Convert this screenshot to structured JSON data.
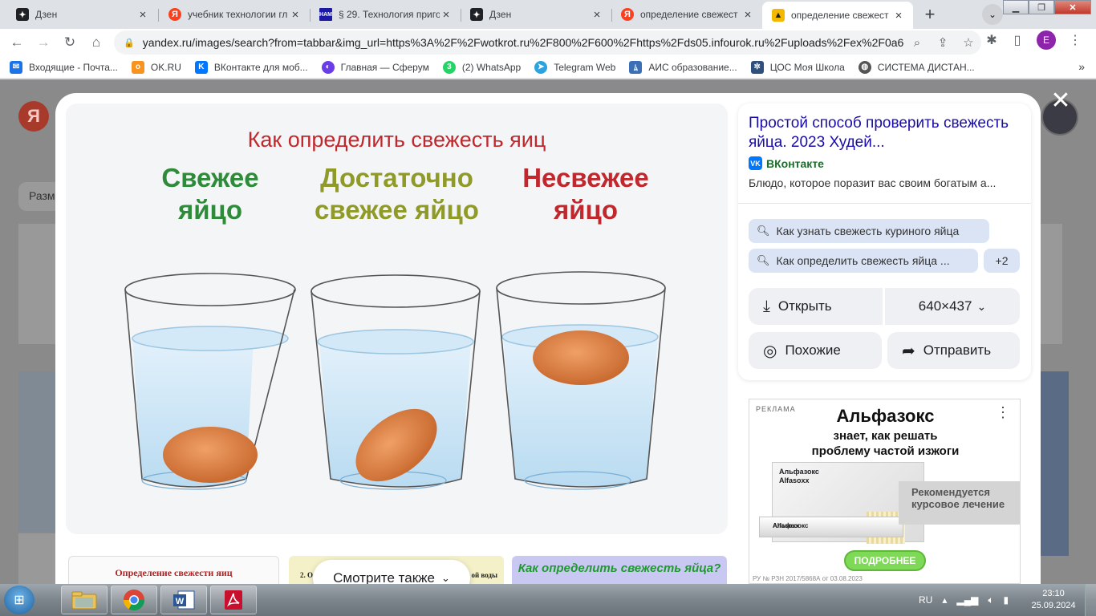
{
  "tabs": [
    {
      "title": "Дзен",
      "icon": "zen-icon",
      "color": "#202124"
    },
    {
      "title": "учебник технологии гл",
      "icon": "yandex-icon",
      "color": "#fc3f1d"
    },
    {
      "title": "§ 29. Технология приго",
      "icon": "nam-icon",
      "color": "#1a1aa6"
    },
    {
      "title": "Дзен",
      "icon": "zen-icon",
      "color": "#202124"
    },
    {
      "title": "определение свежест",
      "icon": "yandex-icon",
      "color": "#fc3f1d"
    },
    {
      "title": "определение свежест",
      "icon": "images-icon",
      "color": "#f5b800"
    }
  ],
  "url": "yandex.ru/images/search?from=tabbar&img_url=https%3A%2F%2Fwotkrot.ru%2F800%2F600%2Fhttps%2Fds05.infourok.ru%2Fuploads%2Fex%2F0a6d...",
  "profile_initial": "E",
  "bookmarks": [
    {
      "label": "Входящие - Почта...",
      "icon": "mail-icon",
      "color": "#1a73e8"
    },
    {
      "label": "OK.RU",
      "icon": "ok-icon",
      "color": "#f7931e"
    },
    {
      "label": "ВКонтакте для моб...",
      "icon": "vk-icon",
      "color": "#0077ff"
    },
    {
      "label": "Главная — Сферум",
      "icon": "sferum-icon",
      "color": "#6a3de8"
    },
    {
      "label": "(2) WhatsApp",
      "icon": "whatsapp-icon",
      "color": "#25d366"
    },
    {
      "label": "Telegram Web",
      "icon": "telegram-icon",
      "color": "#2aa3df"
    },
    {
      "label": "АИС образование...",
      "icon": "ais-icon",
      "color": "#3b6fb6"
    },
    {
      "label": "ЦОС Моя Школа",
      "icon": "school-icon",
      "color": "#2f4f7f"
    },
    {
      "label": "СИСТЕМА ДИСТАН...",
      "icon": "globe-icon",
      "color": "#555555"
    }
  ],
  "bg": {
    "logo": "Я",
    "size_button": "Разм"
  },
  "image": {
    "title": "Как определить свежесть яиц",
    "label_fresh": "Свежее яйцо",
    "label_ok": "Достаточно свежее яйцо",
    "label_stale": "Несвежее яйцо"
  },
  "strips": {
    "s1": "Определение свежести яиц",
    "s2_left": "2. О",
    "s2_right": "ой воды",
    "s3": "Как определить свежесть яйца?"
  },
  "see_also": "Смотрите также",
  "panel": {
    "title": "Простой способ проверить свежесть яйца. 2023 Худей...",
    "source": "ВКонтакте",
    "description": "Блюдо, которое поразит вас своим богатым а...",
    "chips": [
      "Как узнать свежесть куриного яйца",
      "Как определить свежесть яйца ...",
      "+2"
    ],
    "open_label": "Открыть",
    "size_label": "640×437",
    "similar_label": "Похожие",
    "share_label": "Отправить"
  },
  "ad": {
    "tag": "РЕКЛАМА",
    "headline": "Альфазокс",
    "sub1": "знает, как решать",
    "sub2": "проблему частой изжоги",
    "box_name": "Альфазокс",
    "box_name_lat": "Alfasoxx",
    "recommend1": "Рекомендуется",
    "recommend2": "курсовое лечение",
    "button": "ПОДРОБНЕЕ",
    "reg": "РУ № РЗН 2017/5868А от 03.08.2023"
  },
  "taskbar": {
    "lang": "RU",
    "time": "23:10",
    "date": "25.09.2024"
  }
}
